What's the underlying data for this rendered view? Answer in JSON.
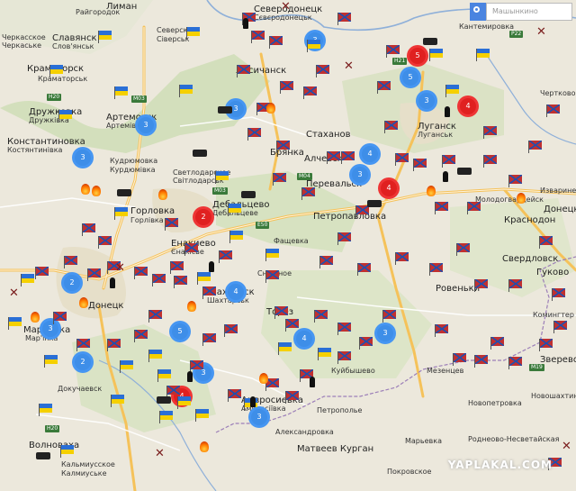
{
  "search": {
    "placeholder": "Машынкино"
  },
  "watermark": "YAPLAKAL.COM",
  "roads": [
    "M03",
    "M04",
    "H20",
    "H21",
    "M03",
    "P22",
    "E50",
    "M19",
    "H20"
  ],
  "cities": [
    {
      "text": "Лиман"
    },
    {
      "text": "Райгородок"
    },
    {
      "text": "Черкасское"
    },
    {
      "text": "Черкаське"
    },
    {
      "text": "Славянск"
    },
    {
      "text": "Слов'янськ"
    },
    {
      "text": "Северск"
    },
    {
      "text": "Сіверськ"
    },
    {
      "text": "Краматорск"
    },
    {
      "text": "Краматорськ"
    },
    {
      "text": "Дружковка"
    },
    {
      "text": "Дружківка"
    },
    {
      "text": "Артемовск"
    },
    {
      "text": "Артемівськ"
    },
    {
      "text": "Константиновка"
    },
    {
      "text": "Костянтинівка"
    },
    {
      "text": "Кудрюмовка"
    },
    {
      "text": "Курдюмівка"
    },
    {
      "text": "Светлодарское"
    },
    {
      "text": "Світлодарськ"
    },
    {
      "text": "Горловка"
    },
    {
      "text": "Горлівка"
    },
    {
      "text": "Дебальцево"
    },
    {
      "text": "Дебальцеве"
    },
    {
      "text": "Енакиево"
    },
    {
      "text": "Єнакієве"
    },
    {
      "text": "Шахтерск"
    },
    {
      "text": "Шахтарськ"
    },
    {
      "text": "Донецк"
    },
    {
      "text": "Марьинка"
    },
    {
      "text": "Мар'їнка"
    },
    {
      "text": "Снежное"
    },
    {
      "text": "Торез"
    },
    {
      "text": "Амвросиевка"
    },
    {
      "text": "Амвросіївка"
    },
    {
      "text": "Докучаевск"
    },
    {
      "text": "Волноваха"
    },
    {
      "text": "Кальмиусское"
    },
    {
      "text": "Калмиуське"
    },
    {
      "text": "Луганск"
    },
    {
      "text": "Луганськ"
    },
    {
      "text": "Северодонецк"
    },
    {
      "text": "Сєвєродонецьк"
    },
    {
      "text": "Лисичанск"
    },
    {
      "text": "Стаханов"
    },
    {
      "text": "Алчевск"
    },
    {
      "text": "Брянка"
    },
    {
      "text": "Перевальск"
    },
    {
      "text": "Фащевка"
    },
    {
      "text": "Ровеньки"
    },
    {
      "text": "Свердловск"
    },
    {
      "text": "Краснодон"
    },
    {
      "text": "Молодогвардейск"
    },
    {
      "text": "Изварине"
    },
    {
      "text": "Новошахтинск"
    },
    {
      "text": "Петропавловка"
    },
    {
      "text": "Куйбышево"
    },
    {
      "text": "Мезенцев"
    },
    {
      "text": "Петрополье"
    },
    {
      "text": "Александровка"
    },
    {
      "text": "Матвеев Курган"
    },
    {
      "text": "Марьевка"
    },
    {
      "text": "Покровское"
    },
    {
      "text": "Новопетровка"
    },
    {
      "text": "Гуково"
    },
    {
      "text": "Комингтер"
    },
    {
      "text": "Зверево"
    },
    {
      "text": "Роднеово-Несветайская"
    },
    {
      "text": "Донецк"
    },
    {
      "text": "Кантемировка"
    },
    {
      "text": "Чертково"
    }
  ]
}
